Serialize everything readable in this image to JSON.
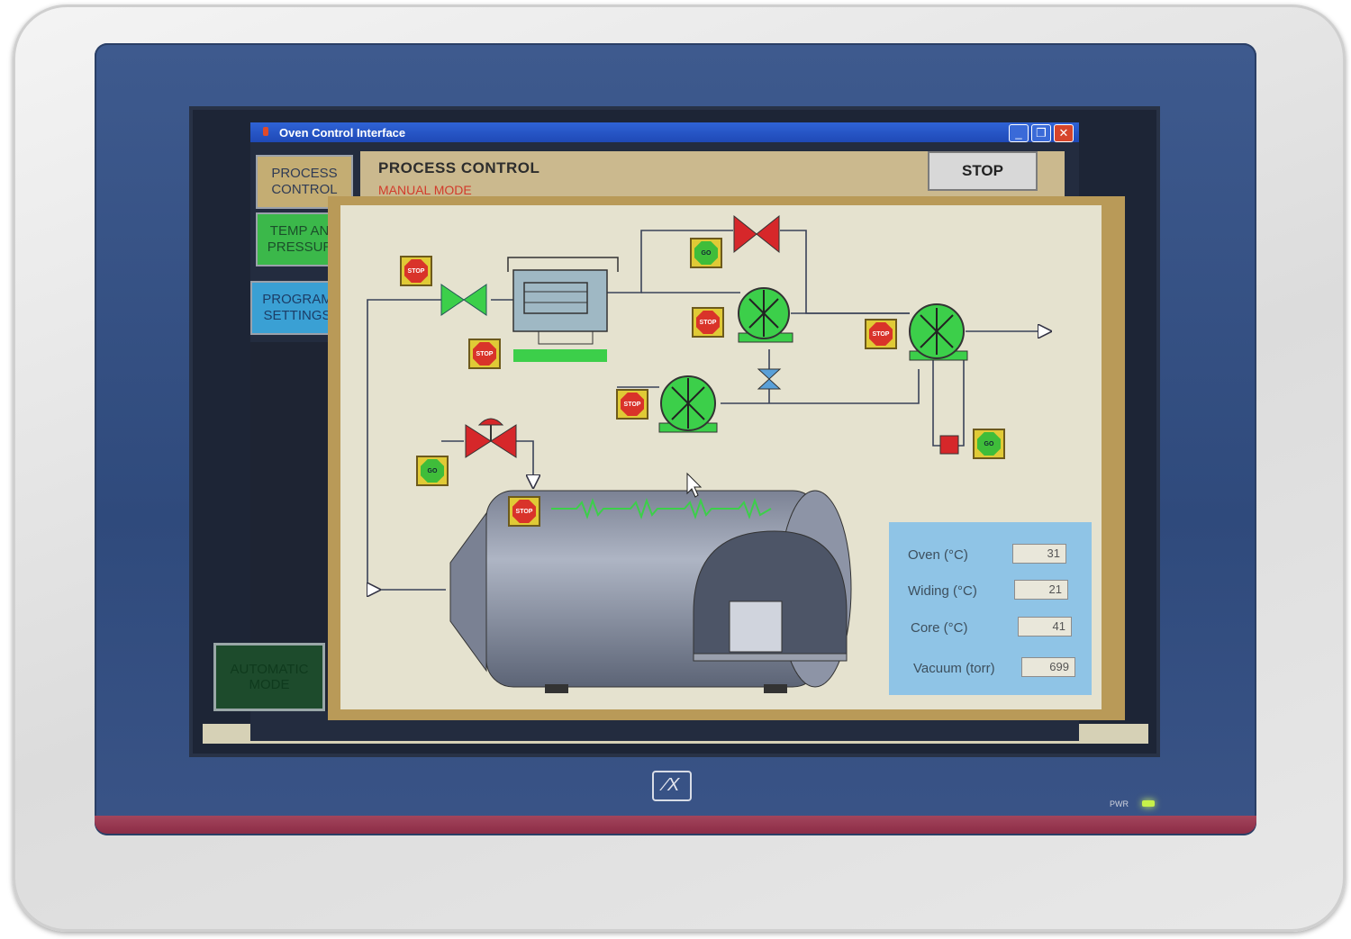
{
  "window": {
    "title": "Oven Control Interface"
  },
  "nav": {
    "process_control": "PROCESS\nCONTROL",
    "temp_pressure": "TEMP AND\nPRESSURE",
    "program_settings": "PROGRAM\nSETTINGS",
    "automatic_mode": "AUTOMATIC\nMODE"
  },
  "header": {
    "title": "PROCESS CONTROL",
    "mode": "MANUAL MODE",
    "stop_label": "STOP"
  },
  "diagram_tags": {
    "stop": "STOP",
    "go": "GO"
  },
  "readouts": [
    {
      "label": "Oven (°C)",
      "value": "31"
    },
    {
      "label": "Widing (°C)",
      "value": "21"
    },
    {
      "label": "Core (°C)",
      "value": "41"
    },
    {
      "label": "Vacuum (torr)",
      "value": "699"
    }
  ],
  "device": {
    "power_label": "PWR"
  },
  "colors": {
    "accent_blue": "#2f63d6",
    "stop_red": "#d9332a",
    "go_green": "#3fbd3a",
    "pump_green": "#3ccf4a",
    "valve_red": "#d6272a"
  }
}
